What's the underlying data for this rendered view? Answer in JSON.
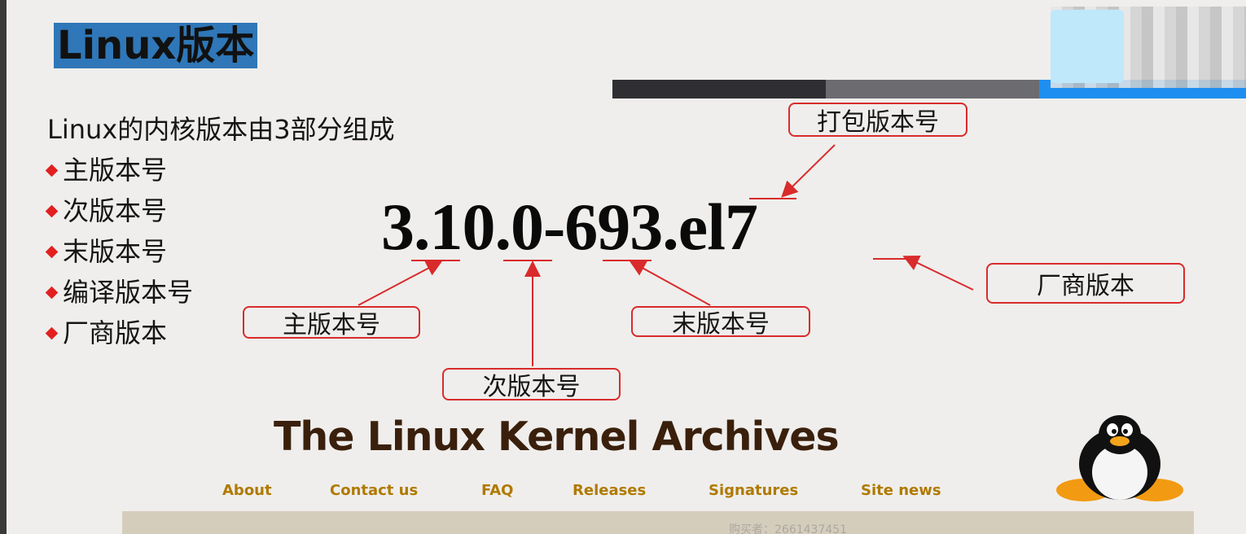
{
  "slide": {
    "title": "Linux版本",
    "intro": "Linux的内核版本由3部分组成",
    "bullets": [
      "主版本号",
      "次版本号",
      "末版本号",
      "编译版本号",
      "厂商版本"
    ],
    "version_string": "3.10.0-693.el7",
    "labels": {
      "package": "打包版本号",
      "major": "主版本号",
      "minor": "次版本号",
      "patch": "末版本号",
      "vendor": "厂商版本"
    }
  },
  "archives": {
    "title": "The Linux Kernel Archives",
    "nav": [
      "About",
      "Contact us",
      "FAQ",
      "Releases",
      "Signatures",
      "Site news"
    ]
  },
  "watermark": "购买者：2661437451",
  "colors": {
    "accent_red": "#d92b2b",
    "title_bg": "#2f77b8",
    "nav_gold": "#b07a00",
    "archives_brown": "#3a200c"
  },
  "icons": [
    "diamond-bullet-icon",
    "penguin-logo-icon"
  ]
}
